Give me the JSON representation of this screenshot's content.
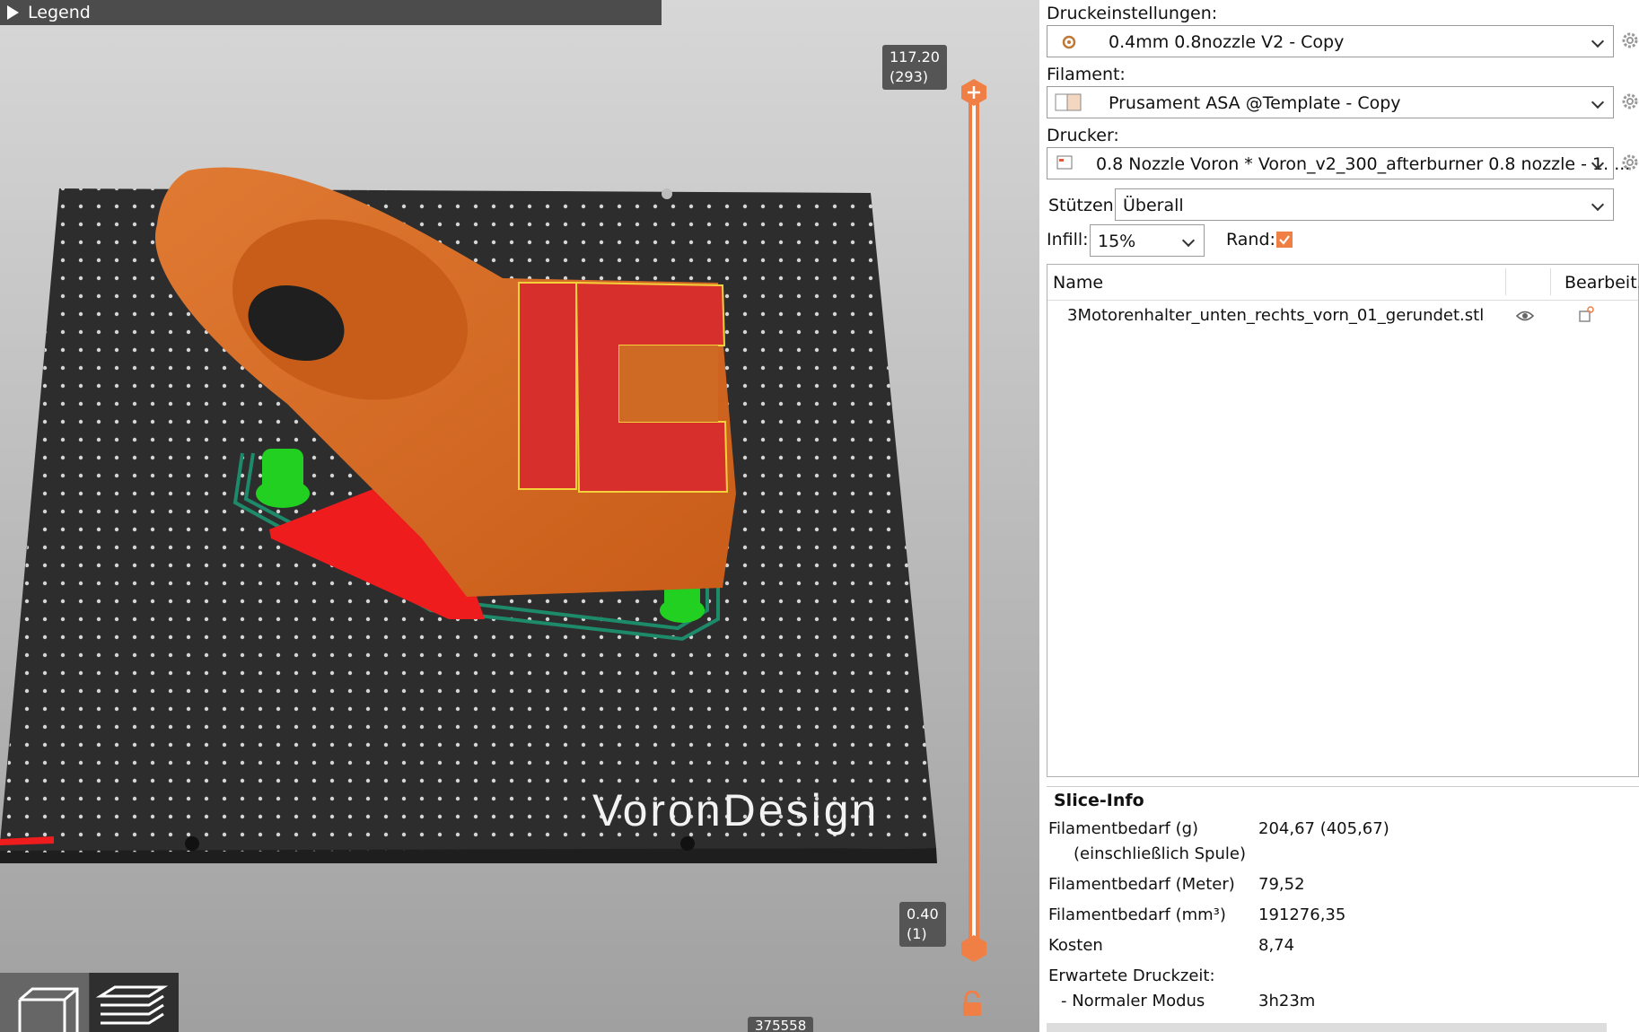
{
  "viewport": {
    "legend_label": "Legend",
    "layer_top": "117.20",
    "layer_top_index": "(293)",
    "layer_bottom": "0.40",
    "layer_bottom_index": "(1)",
    "move_count": "375558",
    "bed_logo": "VoronDesign"
  },
  "panel": {
    "print_settings_label": "Druckeinstellungen:",
    "print_settings_value": "0.4mm 0.8nozzle V2 - Copy",
    "filament_label": "Filament:",
    "filament_value": "Prusament ASA @Template - Copy",
    "printer_label": "Drucker:",
    "printer_value": "0.8 Nozzle Voron  * Voron_v2_300_afterburner 0.8 nozzle - 1. ...",
    "supports_label": "Stützen:",
    "supports_value": "Überall",
    "infill_label": "Infill:",
    "infill_value": "15%",
    "brim_label": "Rand:",
    "brim_checked": true
  },
  "object_list": {
    "col_name": "Name",
    "col_edit": "Bearbeit...",
    "rows": [
      {
        "name": "3Motorenhalter_unten_rechts_vorn_01_gerundet.stl"
      }
    ]
  },
  "slice_info": {
    "title": "Slice-Info",
    "rows": [
      {
        "label": "Filamentbedarf (g)",
        "value": "204,67 (405,67)"
      },
      {
        "label": "(einschließlich Spule)",
        "value": ""
      },
      {
        "label": "Filamentbedarf (Meter)",
        "value": "79,52"
      },
      {
        "label": "Filamentbedarf (mm³)",
        "value": "191276,35"
      },
      {
        "label": "Kosten",
        "value": "8,74"
      },
      {
        "label": "Erwartete Druckzeit:",
        "value": ""
      },
      {
        "label": "- Normaler Modus",
        "value": "3h23m"
      }
    ]
  },
  "colors": {
    "accent": "#f07f45",
    "model": "#d4651e",
    "support": "#2bd62b",
    "bed": "#2e2e2e"
  }
}
